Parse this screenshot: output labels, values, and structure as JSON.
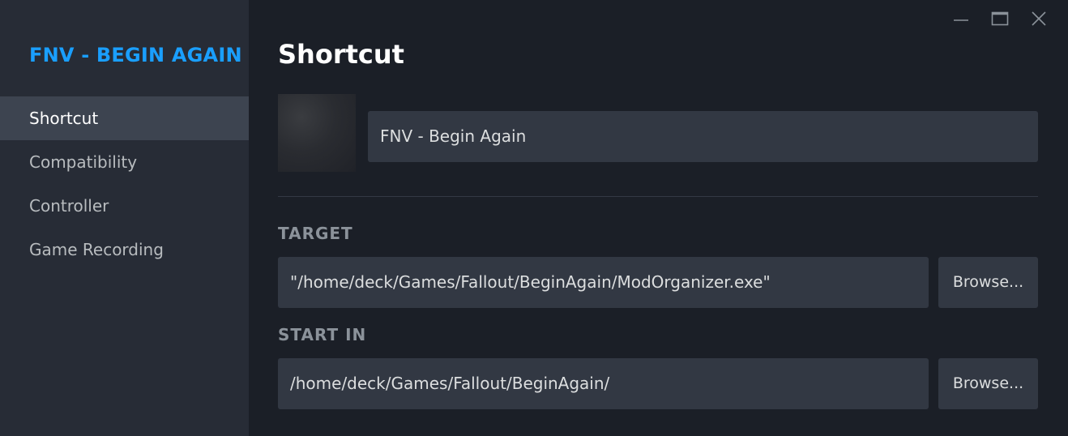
{
  "sidebar": {
    "app_title": "FNV - BEGIN AGAIN",
    "items": [
      {
        "label": "Shortcut",
        "active": true
      },
      {
        "label": "Compatibility",
        "active": false
      },
      {
        "label": "Controller",
        "active": false
      },
      {
        "label": "Game Recording",
        "active": false
      }
    ]
  },
  "window_controls": {
    "icons": [
      "minimize-icon",
      "maximize-icon",
      "close-icon"
    ]
  },
  "main": {
    "title": "Shortcut",
    "shortcut_name": "FNV - Begin Again",
    "target": {
      "label": "TARGET",
      "value": "\"/home/deck/Games/Fallout/BeginAgain/ModOrganizer.exe\"",
      "browse_label": "Browse..."
    },
    "start_in": {
      "label": "START IN",
      "value": "/home/deck/Games/Fallout/BeginAgain/",
      "browse_label": "Browse..."
    }
  },
  "colors": {
    "accent": "#1a9fff",
    "sidebar_bg": "#272c36",
    "main_bg": "#1b1f27",
    "field_bg": "#323843",
    "active_item_bg": "#3d4450"
  }
}
